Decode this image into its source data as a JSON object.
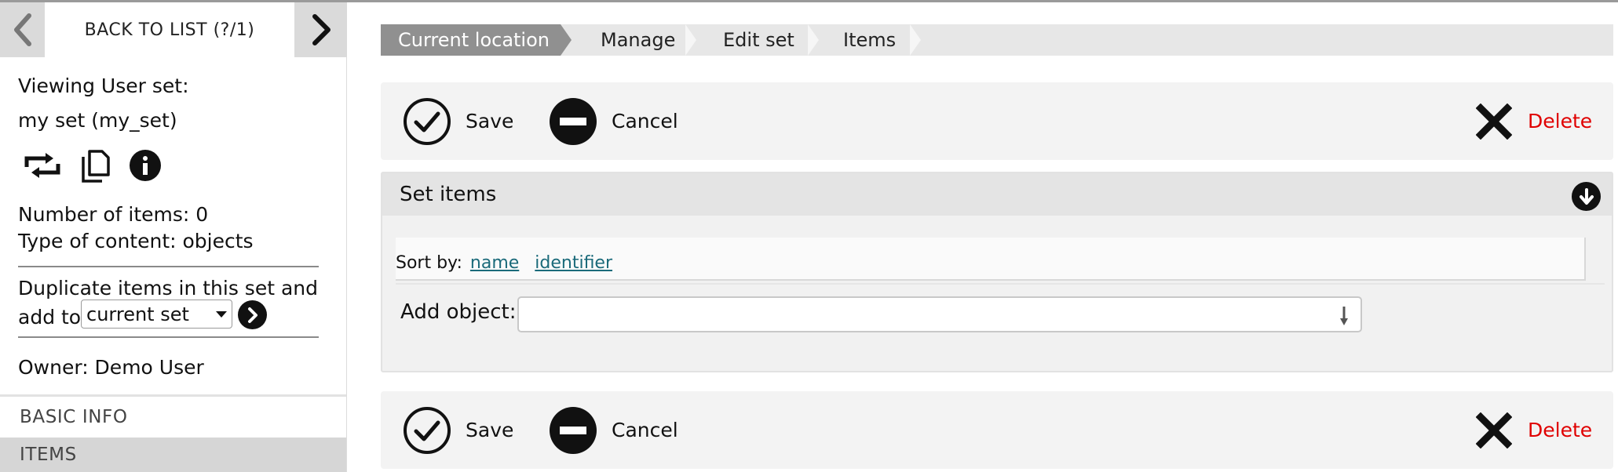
{
  "sidebar": {
    "back_label": "BACK TO LIST (?/1)",
    "viewing_label": "Viewing User set:",
    "set_name": "my set (my_set)",
    "icons": [
      "swap-icon",
      "copy-icon",
      "info-icon"
    ],
    "num_items": "Number of items: 0",
    "content_type": "Type of content: objects",
    "duplicate_text": "Duplicate items in this set and",
    "add_to_label": "add to",
    "add_to_selected": "current set",
    "owner": "Owner: Demo User",
    "sections": [
      "BASIC INFO",
      "ITEMS"
    ]
  },
  "breadcrumb": [
    "Current location",
    "Manage",
    "Edit set",
    "Items"
  ],
  "actions": {
    "save": "Save",
    "cancel": "Cancel",
    "delete": "Delete"
  },
  "panel": {
    "title": "Set items",
    "sort_label": "Sort by:",
    "sort_links": [
      "name",
      "identifier"
    ],
    "add_object_label": "Add object:",
    "add_object_value": ""
  },
  "colors": {
    "delete": "#e00000",
    "link": "#1a6a7a",
    "breadcrumb_active": "#909090"
  }
}
